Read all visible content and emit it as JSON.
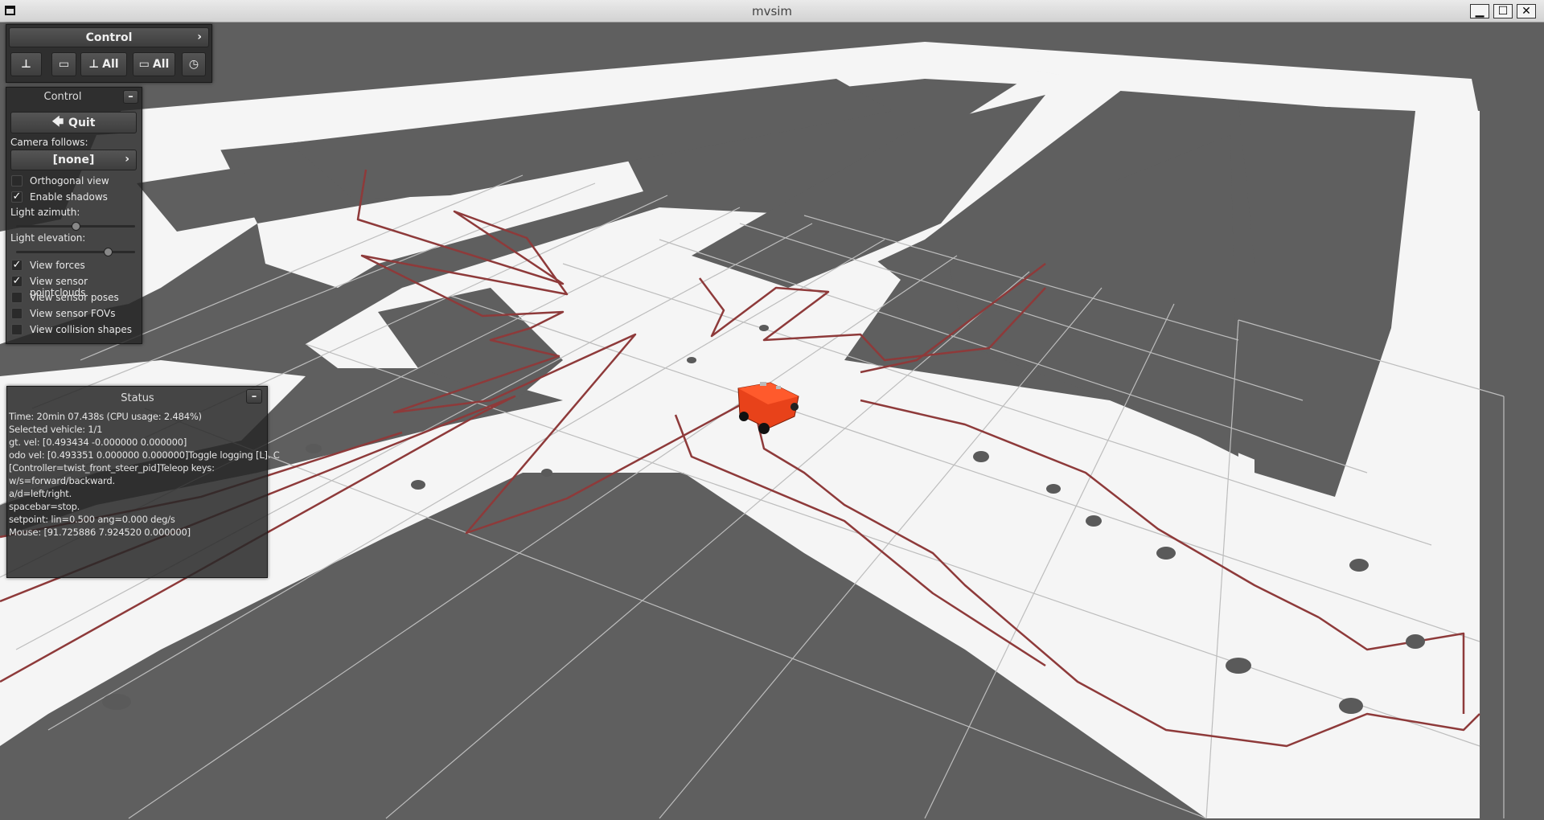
{
  "window": {
    "title": "mvsim",
    "minimize_glyph": "▁",
    "maximize_glyph": "☐",
    "close_glyph": "✕"
  },
  "toolbar": {
    "title": "Control",
    "expand_glyph": "›",
    "buttons": [
      {
        "icon": "⊥",
        "label": ""
      },
      {
        "icon": "▭",
        "label": ""
      },
      {
        "icon": "⊥",
        "label": "All"
      },
      {
        "icon": "▭",
        "label": "All"
      },
      {
        "icon": "◷",
        "label": ""
      }
    ]
  },
  "control": {
    "title": "Control",
    "collapse_glyph": "–",
    "quit_icon": "🡄",
    "quit_label": "Quit",
    "camera_follows_label": "Camera follows:",
    "camera_follows_value": "[none]",
    "camera_follows_chevron": "›",
    "options_top": [
      {
        "label": "Orthogonal view",
        "checked": false
      },
      {
        "label": "Enable shadows",
        "checked": true
      }
    ],
    "light_azimuth_label": "Light azimuth:",
    "light_azimuth_level": 0.5,
    "light_elevation_label": "Light elevation:",
    "light_elevation_level": 0.77,
    "options_bottom": [
      {
        "label": "View forces",
        "checked": true
      },
      {
        "label": "View sensor pointclouds",
        "checked": true
      },
      {
        "label": "View sensor poses",
        "checked": false
      },
      {
        "label": "View sensor FOVs",
        "checked": false
      },
      {
        "label": "View collision shapes",
        "checked": false
      }
    ],
    "check_glyph": "✓"
  },
  "status": {
    "title": "Status",
    "collapse_glyph": "–",
    "lines": [
      "Time: 20min 07.438s (CPU usage: 2.484%)",
      "Selected vehicle: 1/1",
      "gt. vel: [0.493434 -0.000000 0.000000]",
      "odo vel: [0.493351 0.000000 0.000000]Toggle logging [L]. C",
      "[Controller=twist_front_steer_pid]Teleop keys:",
      "w/s=forward/backward.",
      "a/d=left/right.",
      "spacebar=stop.",
      "setpoint: lin=0.500 ang=0.000 deg/s",
      "Mouse: [91.725886 7.924520 0.000000]"
    ]
  },
  "scene": {
    "floor_color": "#5f5f5f",
    "free_space_color": "#f7f7f7",
    "grid_color": "#bcbcbc",
    "trajectory_color": "#8e3a3a",
    "robot_color": "#e8421a"
  }
}
